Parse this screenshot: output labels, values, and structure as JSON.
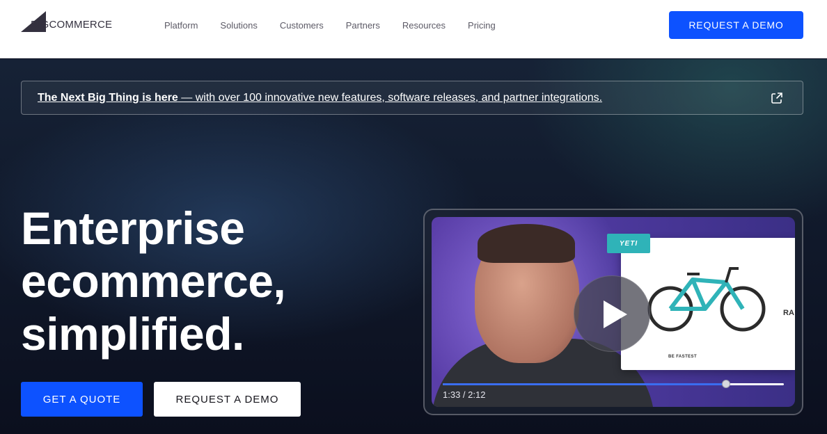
{
  "header": {
    "logo_text": "BIGCOMMERCE",
    "nav": [
      "Platform",
      "Solutions",
      "Customers",
      "Partners",
      "Resources",
      "Pricing"
    ],
    "cta_label": "REQUEST A DEMO"
  },
  "banner": {
    "strong": "The Next Big Thing is here",
    "rest": " — with over 100 innovative new features, software releases, and partner integrations.",
    "icon": "external-link-icon"
  },
  "hero": {
    "headline": [
      "Enterprise",
      "ecommerce,",
      "simplified."
    ],
    "primary_cta": "GET A QUOTE",
    "secondary_cta": "REQUEST A DEMO"
  },
  "video": {
    "brand_tag": "YETI",
    "caption": "BE FASTEST",
    "side_text": "RA",
    "time": "1:33 / 2:12",
    "progress_fraction": 0.83,
    "play_icon": "play-icon"
  },
  "colors": {
    "primary": "#0d52ff",
    "accent_teal": "#2fb3b8",
    "video_purple": "#5a3ea8"
  }
}
